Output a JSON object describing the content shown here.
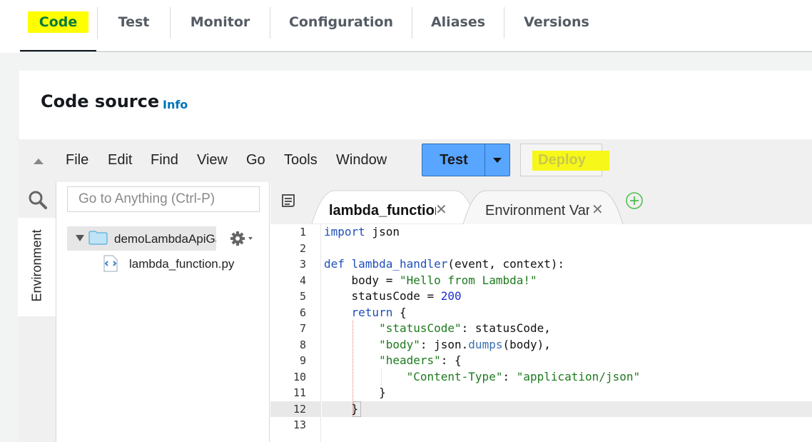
{
  "tabs": [
    {
      "label": "Code",
      "active": true
    },
    {
      "label": "Test"
    },
    {
      "label": "Monitor"
    },
    {
      "label": "Configuration"
    },
    {
      "label": "Aliases"
    },
    {
      "label": "Versions"
    }
  ],
  "highlight_color": "#ffff00",
  "panel": {
    "title": "Code source",
    "info": "Info"
  },
  "menu": [
    "File",
    "Edit",
    "Find",
    "View",
    "Go",
    "Tools",
    "Window"
  ],
  "buttons": {
    "test": "Test",
    "deploy": "Deploy"
  },
  "sidebar": {
    "goto_placeholder": "Go to Anything (Ctrl-P)",
    "environment_tab": "Environment",
    "folder": "demoLambdaApiGateway",
    "file": "lambda_function.py"
  },
  "editor_tabs": [
    {
      "label": "lambda_function",
      "active": true
    },
    {
      "label": "Environment Variables",
      "active": false
    }
  ],
  "line_numbers": [
    "1",
    "2",
    "3",
    "4",
    "5",
    "6",
    "7",
    "8",
    "9",
    "10",
    "11",
    "12",
    "13"
  ],
  "code": {
    "l1": {
      "kw": "import",
      "rest": " json"
    },
    "l3": {
      "kw": "def",
      "fn": "lambda_handler",
      "rest": "(event, context):"
    },
    "l4": {
      "a": "    body = ",
      "s": "\"Hello from Lambda!\""
    },
    "l5": {
      "a": "    statusCode = ",
      "n": "200"
    },
    "l6": {
      "kw": "return",
      "rest": " {"
    },
    "l7": {
      "s": "\"statusCode\"",
      "rest": ": statusCode,"
    },
    "l8": {
      "s": "\"body\"",
      "a": ": json.",
      "m": "dumps",
      "rest": "(body),"
    },
    "l9": {
      "s": "\"headers\"",
      "rest": ": {"
    },
    "l10": {
      "s": "\"Content-Type\"",
      "a": ": ",
      "s2": "\"application/json\""
    },
    "l11": {
      "rest": "}"
    },
    "l12": {
      "rest": "}"
    }
  }
}
